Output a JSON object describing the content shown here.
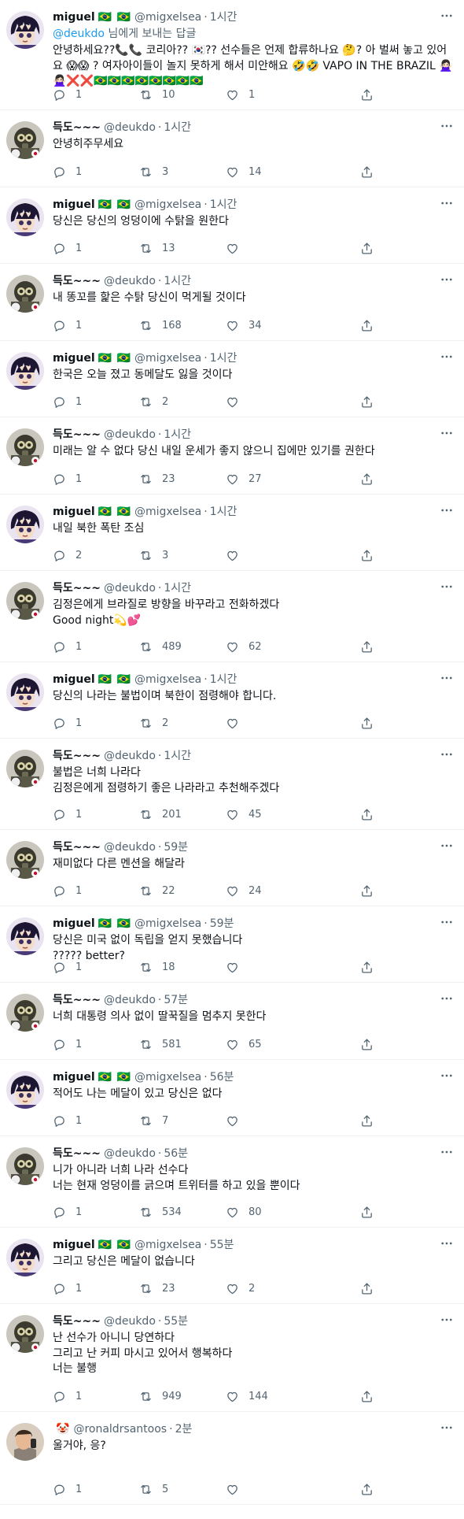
{
  "reply_to": {
    "prefix": "",
    "mention": "@deukdo",
    "suffix": " 님에게 보내는 답글"
  },
  "tweets": [
    {
      "user": "miguel",
      "flags": "🇧🇷 🇧🇷",
      "handle": "@migxelsea",
      "time": "1시간",
      "text": "안녕하세요??📞📞 코리아?? 🇰🇷?? 선수들은 언제 합류하나요 🤔? 아 벌써 놓고 있어요 😱😱 ? 여자아이들이 놀지 못하게 해서 미안해요 🤣🤣 VAPO IN THE BRAZIL 🙅🏻‍♀️🙅🏻‍♀️❌❌🇧🇷🇧🇷🇧🇷🇧🇷🇧🇷🇧🇷🇧🇷🇧🇷",
      "replies": "1",
      "retweets": "10",
      "likes": "1"
    },
    {
      "user": "득도~~~",
      "flags": "",
      "handle": "@deukdo",
      "time": "1시간",
      "text": "안녕히주무세요",
      "replies": "1",
      "retweets": "3",
      "likes": "14"
    },
    {
      "user": "miguel",
      "flags": "🇧🇷 🇧🇷",
      "handle": "@migxelsea",
      "time": "1시간",
      "text": "당신은 당신의 엉덩이에 수탉을 원한다",
      "replies": "1",
      "retweets": "13",
      "likes": ""
    },
    {
      "user": "득도~~~",
      "flags": "",
      "handle": "@deukdo",
      "time": "1시간",
      "text": "내 똥꼬를 핥은 수탉 당신이 먹게될 것이다",
      "replies": "1",
      "retweets": "168",
      "likes": "34"
    },
    {
      "user": "miguel",
      "flags": "🇧🇷 🇧🇷",
      "handle": "@migxelsea",
      "time": "1시간",
      "text": "한국은 오늘 졌고 동메달도 잃을 것이다",
      "replies": "1",
      "retweets": "2",
      "likes": ""
    },
    {
      "user": "득도~~~",
      "flags": "",
      "handle": "@deukdo",
      "time": "1시간",
      "text": "미래는 알 수 없다 당신 내일 운세가 좋지 않으니 집에만 있기를 권한다",
      "replies": "1",
      "retweets": "23",
      "likes": "27"
    },
    {
      "user": "miguel",
      "flags": "🇧🇷 🇧🇷",
      "handle": "@migxelsea",
      "time": "1시간",
      "text": "내일 북한 폭탄 조심",
      "replies": "2",
      "retweets": "3",
      "likes": ""
    },
    {
      "user": "득도~~~",
      "flags": "",
      "handle": "@deukdo",
      "time": "1시간",
      "text": "김정은에게 브라질로 방향을 바꾸라고 전화하겠다\nGood night💫💕",
      "replies": "1",
      "retweets": "489",
      "likes": "62"
    },
    {
      "user": "miguel",
      "flags": "🇧🇷 🇧🇷",
      "handle": "@migxelsea",
      "time": "1시간",
      "text": "당신의 나라는 불법이며 북한이 점령해야 합니다.",
      "replies": "1",
      "retweets": "2",
      "likes": ""
    },
    {
      "user": "득도~~~",
      "flags": "",
      "handle": "@deukdo",
      "time": "1시간",
      "text": "불법은 너희 나라다\n김정은에게 점령하기 좋은 나라라고 추천해주겠다",
      "replies": "1",
      "retweets": "201",
      "likes": "45"
    },
    {
      "user": "득도~~~",
      "flags": "",
      "handle": "@deukdo",
      "time": "59분",
      "text": "재미없다 다른 멘션을 해달라",
      "replies": "1",
      "retweets": "22",
      "likes": "24"
    },
    {
      "user": "miguel",
      "flags": "🇧🇷 🇧🇷",
      "handle": "@migxelsea",
      "time": "59분",
      "text": "당신은 미국 없이 독립을 얻지 못했습니다\n????? better?",
      "replies": "1",
      "retweets": "18",
      "likes": ""
    },
    {
      "user": "득도~~~",
      "flags": "",
      "handle": "@deukdo",
      "time": "57분",
      "text": "너희 대통령 의사 없이 딸꾹질을 멈추지 못한다",
      "replies": "1",
      "retweets": "581",
      "likes": "65"
    },
    {
      "user": "miguel",
      "flags": "🇧🇷 🇧🇷",
      "handle": "@migxelsea",
      "time": "56분",
      "text": "적어도 나는 메달이 있고 당신은 없다",
      "replies": "1",
      "retweets": "7",
      "likes": ""
    },
    {
      "user": "득도~~~",
      "flags": "",
      "handle": "@deukdo",
      "time": "56분",
      "text": "니가 아니라 너희 나라 선수다\n너는 현재 엉덩이를 긁으며 트위터를 하고 있을 뿐이다",
      "replies": "1",
      "retweets": "534",
      "likes": "80"
    },
    {
      "user": "miguel",
      "flags": "🇧🇷 🇧🇷",
      "handle": "@migxelsea",
      "time": "55분",
      "text": "그리고 당신은 메달이 없습니다",
      "replies": "1",
      "retweets": "23",
      "likes": "2"
    },
    {
      "user": "득도~~~",
      "flags": "",
      "handle": "@deukdo",
      "time": "55분",
      "text": "난 선수가 아니니 당연하다\n그리고 난 커피 마시고 있어서 행복하다\n너는 불행",
      "replies": "1",
      "retweets": "949",
      "likes": "144"
    },
    {
      "user": "",
      "flags": "🤡",
      "handle": "@ronaldrsantoos",
      "time": "2분",
      "text": "울거야, 응?",
      "replies": "1",
      "retweets": "5",
      "likes": ""
    }
  ],
  "colors": {
    "accent": "#1d9bf0",
    "muted": "#536471",
    "divider": "#eff3f4"
  }
}
